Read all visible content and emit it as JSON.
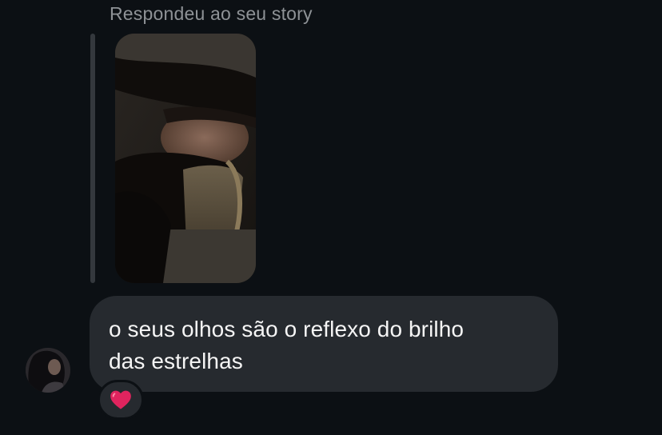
{
  "story_reply": {
    "label": "Respondeu ao seu story"
  },
  "message": {
    "lines": [
      "o seus olhos são o reflexo do brilho",
      "das estrelhas"
    ]
  },
  "reaction": {
    "emoji": "heart-icon",
    "color": "#e0245e"
  },
  "colors": {
    "background": "#0c1014",
    "bubble": "#262a2f",
    "muted_text": "#8e9296",
    "text": "#f5f5f5"
  }
}
